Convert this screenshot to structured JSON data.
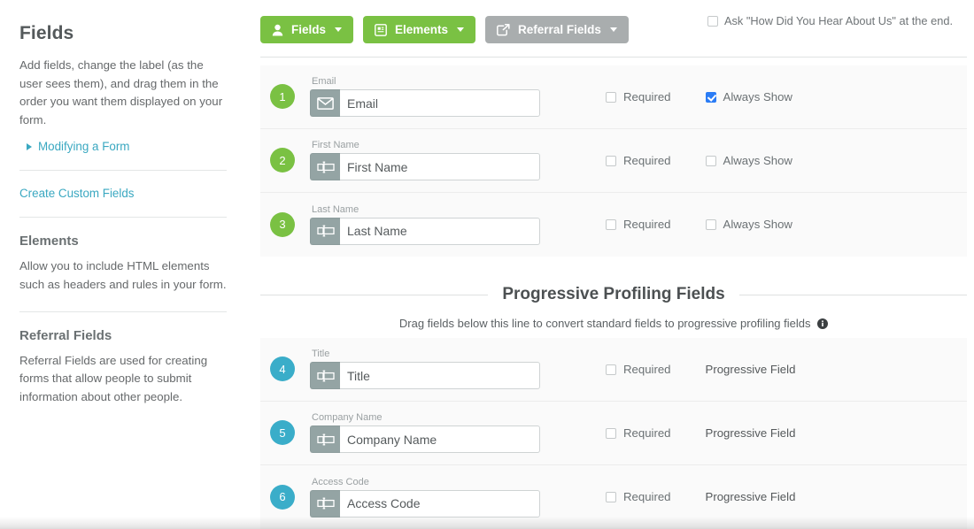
{
  "sidebar": {
    "fields_heading": "Fields",
    "fields_desc": "Add fields, change the label (as the user sees them), and drag them in the order you want them displayed on your form.",
    "modifying_link": "Modifying a Form",
    "create_custom_link": "Create Custom Fields",
    "elements_heading": "Elements",
    "elements_desc": "Allow you to include HTML elements such as headers and rules in your form.",
    "referral_heading": "Referral Fields",
    "referral_desc": "Referral Fields are used for creating forms that allow people to submit information about other people."
  },
  "toolbar": {
    "fields_button": "Fields",
    "elements_button": "Elements",
    "referral_button": "Referral Fields",
    "ask_checkbox_label": "Ask \"How Did You Hear About Us\" at the end.",
    "ask_checkbox_checked": false,
    "colors": {
      "green": "#7ac143",
      "grey": "#a9adae",
      "teal": "#3aadc9",
      "link": "#3aa8c1",
      "checkbox_blue": "#2b7cf5"
    },
    "icons": {
      "fields": "person-icon",
      "elements": "document-icon",
      "referral": "share-icon"
    }
  },
  "standard_fields": [
    {
      "number": "1",
      "label": "Email",
      "value": "Email",
      "placeholder": "Email",
      "icon": "envelope-icon",
      "required_label": "Required",
      "required_checked": false,
      "always_show_label": "Always Show",
      "always_show_checked": true
    },
    {
      "number": "2",
      "label": "First Name",
      "value": "First Name",
      "placeholder": "First Name",
      "icon": "text-field-icon",
      "required_label": "Required",
      "required_checked": false,
      "always_show_label": "Always Show",
      "always_show_checked": false
    },
    {
      "number": "3",
      "label": "Last Name",
      "value": "Last Name",
      "placeholder": "Last Name",
      "icon": "text-field-icon",
      "required_label": "Required",
      "required_checked": false,
      "always_show_label": "Always Show",
      "always_show_checked": false
    }
  ],
  "progressive_section": {
    "title": "Progressive Profiling Fields",
    "description": "Drag fields below this line to convert standard fields to progressive profiling fields",
    "info_icon": "info-icon"
  },
  "progressive_fields": [
    {
      "number": "4",
      "label": "Title",
      "value": "Title",
      "placeholder": "Title",
      "icon": "text-field-icon",
      "required_label": "Required",
      "required_checked": false,
      "tag": "Progressive Field"
    },
    {
      "number": "5",
      "label": "Company Name",
      "value": "Company Name",
      "placeholder": "Company Name",
      "icon": "text-field-icon",
      "required_label": "Required",
      "required_checked": false,
      "tag": "Progressive Field"
    },
    {
      "number": "6",
      "label": "Access Code",
      "value": "Access Code",
      "placeholder": "Access Code",
      "icon": "text-field-icon",
      "required_label": "Required",
      "required_checked": false,
      "tag": "Progressive Field"
    }
  ]
}
